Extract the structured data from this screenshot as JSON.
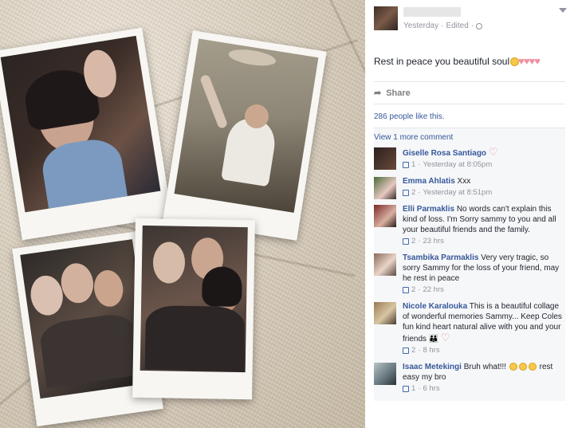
{
  "post": {
    "timestamp": "Yesterday",
    "edited": "Edited",
    "separator": "·",
    "text": "Rest in peace you beautiful soul",
    "share_label": "Share",
    "likes_text": "286 people like this.",
    "more_comments": "View 1 more comment"
  },
  "comments": [
    {
      "name": "Giselle Rosa Santiago",
      "text": "",
      "likes": "1",
      "time": "Yesterday at 8:05pm",
      "emoji": "heart"
    },
    {
      "name": "Emma Ahlatis",
      "text": "Xxx",
      "likes": "2",
      "time": "Yesterday at 8:51pm"
    },
    {
      "name": "Elli Parmaklis",
      "text": "No words can't explain this kind of loss. I'm Sorry sammy to you and all your beautiful friends and the family.",
      "likes": "2",
      "time": "23 hrs"
    },
    {
      "name": "Tsambika Parmaklis",
      "text": "Very very tragic, so sorry Sammy for the loss of your friend, may he rest in peace",
      "likes": "2",
      "time": "22 hrs"
    },
    {
      "name": "Nicole Karalouka",
      "text": "This is a beautiful collage of wonderful memories Sammy... Keep Coles fun kind heart natural alive with you and your friends",
      "likes": "2",
      "time": "8 hrs",
      "emoji": "family-heart"
    },
    {
      "name": "Isaac Metekingi",
      "text": "Bruh what!!!",
      "text_after": "rest easy my bro",
      "likes": "1",
      "time": "6 hrs",
      "emoji": "tears"
    }
  ],
  "colors": {
    "link": "#365899",
    "meta": "#90949c",
    "heart": "#f08fa2"
  }
}
